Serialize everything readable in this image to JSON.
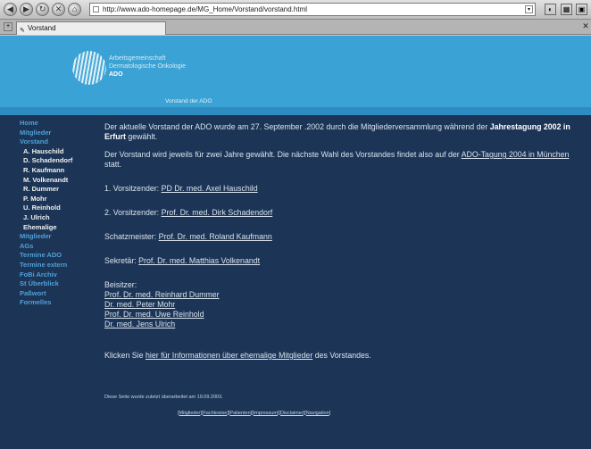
{
  "browser": {
    "url": "http://www.ado-homepage.de/MG_Home/Vorstand/vorstand.html",
    "tab_title": "Vorstand"
  },
  "header": {
    "org_lines": [
      "Arbeitsgemeinschaft",
      "Dermatologische Onkologie"
    ],
    "org_short": "ADO",
    "page_title": "Vorstand der ADO"
  },
  "sidebar": {
    "items": [
      {
        "label": "Home",
        "level": 0
      },
      {
        "label": "Mitglieder",
        "level": 0
      },
      {
        "label": "Vorstand",
        "level": 0
      },
      {
        "label": "A. Hauschild",
        "level": 1
      },
      {
        "label": "D. Schadendorf",
        "level": 1
      },
      {
        "label": "R. Kaufmann",
        "level": 1
      },
      {
        "label": "M. Volkenandt",
        "level": 1
      },
      {
        "label": "R. Dummer",
        "level": 1
      },
      {
        "label": "P. Mohr",
        "level": 1
      },
      {
        "label": "U. Reinhold",
        "level": 1
      },
      {
        "label": "J. Ulrich",
        "level": 1
      },
      {
        "label": "Ehemalige",
        "level": 1
      },
      {
        "label": "Mitglieder",
        "level": 0
      },
      {
        "label": "AGs",
        "level": 0
      },
      {
        "label": "Termine ADO",
        "level": 0
      },
      {
        "label": "Termine extern",
        "level": 0
      },
      {
        "label": "FoBi Archiv",
        "level": 0
      },
      {
        "label": "St Überblick",
        "level": 0
      },
      {
        "label": "Paßwort",
        "level": 0
      },
      {
        "label": "Formelles",
        "level": 0
      }
    ]
  },
  "content": {
    "intro_a": "Der aktuelle Vorstand der ADO wurde am 27. September .2002 durch die Mitgliederversammlung während der ",
    "intro_bold": "Jahrestagung 2002 in Erfurt",
    "intro_b": " gewählt.",
    "term_a": "Der Vorstand wird jeweils für zwei Jahre gewählt. Die nächste Wahl des Vorstandes findet also auf der ",
    "term_link": "ADO-Tagung 2004 in München",
    "term_b": " statt.",
    "chair1_label": "1. Vorsitzender: ",
    "chair1_name": "PD Dr. med. Axel Hauschild",
    "chair2_label": "2. Vorsitzender: ",
    "chair2_name": "Prof. Dr. med. Dirk Schadendorf",
    "treasurer_label": "Schatzmeister: ",
    "treasurer_name": "Prof. Dr. med. Roland Kaufmann",
    "secretary_label": "Sekretär: ",
    "secretary_name": "Prof. Dr. med. Matthias Volkenandt",
    "assessors_label": "Beisitzer:",
    "assessors": [
      "Prof. Dr. med. Reinhard Dummer",
      "Dr. med. Peter Mohr",
      "Prof. Dr. med. Uwe Reinhold",
      "Dr. med. Jens Ulrich"
    ],
    "former_a": "Klicken Sie ",
    "former_link": "hier für Informationen über ehemalige Mitglieder",
    "former_b": " des Vorstandes.",
    "updated": "Diese Seite wurde zuletzt überarbeitet am 19.09.2003."
  },
  "footer": {
    "links": [
      "Mitglieder",
      "Fachkreise",
      "Patienten",
      "Impressum",
      "Disclaimer",
      "Navigation"
    ]
  }
}
